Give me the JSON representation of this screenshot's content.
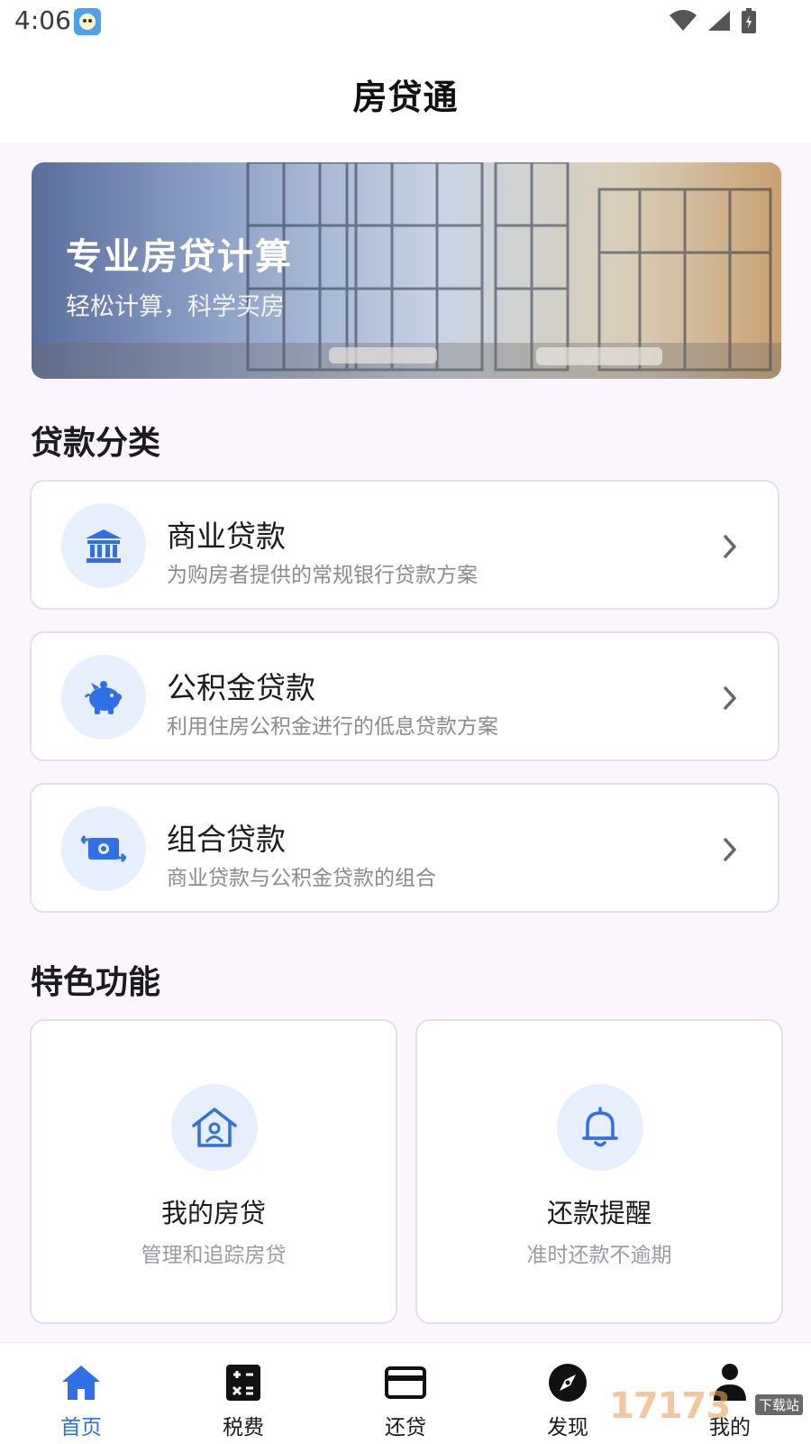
{
  "status_bar": {
    "time": "4:06"
  },
  "app_bar": {
    "title": "房贷通"
  },
  "banner": {
    "title": "专业房贷计算",
    "subtitle": "轻松计算，科学买房"
  },
  "loan_section": {
    "title": "贷款分类",
    "items": [
      {
        "title": "商业贷款",
        "description": "为购房者提供的常规银行贷款方案",
        "icon": "bank-icon"
      },
      {
        "title": "公积金贷款",
        "description": "利用住房公积金进行的低息贷款方案",
        "icon": "piggy-bank-icon"
      },
      {
        "title": "组合贷款",
        "description": "商业贷款与公积金贷款的组合",
        "icon": "money-exchange-icon"
      }
    ]
  },
  "feature_section": {
    "title": "特色功能",
    "items": [
      {
        "title": "我的房贷",
        "description": "管理和追踪房贷",
        "icon": "house-user-icon"
      },
      {
        "title": "还款提醒",
        "description": "准时还款不逾期",
        "icon": "bell-icon"
      }
    ]
  },
  "bottom_nav": {
    "items": [
      {
        "label": "首页",
        "icon": "home-icon",
        "active": true
      },
      {
        "label": "税费",
        "icon": "calculator-icon",
        "active": false
      },
      {
        "label": "还贷",
        "icon": "credit-card-icon",
        "active": false
      },
      {
        "label": "发现",
        "icon": "compass-icon",
        "active": false
      },
      {
        "label": "我的",
        "icon": "person-icon",
        "active": false
      }
    ]
  },
  "watermark": {
    "text": "17173",
    "tag": "下载站"
  },
  "colors": {
    "accent": "#2f6fe8",
    "icon_bg": "#e7eefc",
    "page_bg": "#fbf6fd"
  }
}
